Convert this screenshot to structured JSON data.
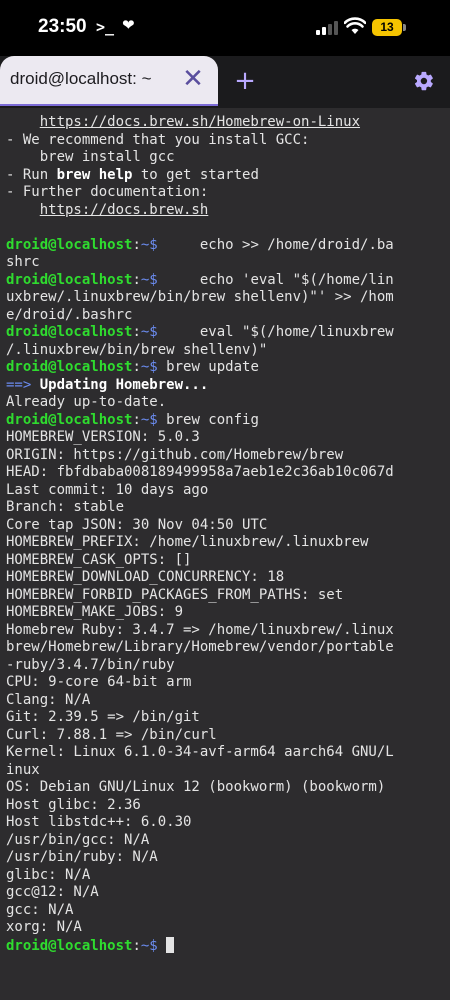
{
  "status_bar": {
    "time": "23:50",
    "terminal_glyph": ">_",
    "heart_glyph": "❤",
    "battery": "13"
  },
  "tab": {
    "title": "droid@localhost: ~",
    "close_glyph": "✕",
    "new_tab_glyph": "+"
  },
  "terminal": {
    "prompt_user": "droid@localhost",
    "prompt_path": "~",
    "lines": [
      {
        "t": "    https://docs.brew.sh/Homebrew-on-Linux"
      },
      {
        "t": "- We recommend that you install GCC:"
      },
      {
        "t": "    brew install gcc"
      },
      {
        "t": "- Run brew help to get started"
      },
      {
        "t": "- Further documentation:"
      },
      {
        "t": "    https://docs.brew.sh"
      },
      {
        "t": ""
      },
      {
        "t": "     echo >> /home/droid/.ba"
      },
      {
        "t": "shrc"
      },
      {
        "t": "     echo 'eval \"$(/home/lin"
      },
      {
        "t": "uxbrew/.linuxbrew/bin/brew shellenv)\"' >> /hom"
      },
      {
        "t": "e/droid/.bashrc"
      },
      {
        "t": "     eval \"$(/home/linuxbrew"
      },
      {
        "t": "/.linuxbrew/bin/brew shellenv)\""
      },
      {
        "t": " brew update"
      },
      {
        "t": "Updating Homebrew..."
      },
      {
        "t": "Already up-to-date."
      },
      {
        "t": " brew config"
      },
      {
        "t": "HOMEBREW_VERSION: 5.0.3"
      },
      {
        "t": "ORIGIN: https://github.com/Homebrew/brew"
      },
      {
        "t": "HEAD: fbfdbaba008189499958a7aeb1e2c36ab10c067d"
      },
      {
        "t": "Last commit: 10 days ago"
      },
      {
        "t": "Branch: stable"
      },
      {
        "t": "Core tap JSON: 30 Nov 04:50 UTC"
      },
      {
        "t": "HOMEBREW_PREFIX: /home/linuxbrew/.linuxbrew"
      },
      {
        "t": "HOMEBREW_CASK_OPTS: []"
      },
      {
        "t": "HOMEBREW_DOWNLOAD_CONCURRENCY: 18"
      },
      {
        "t": "HOMEBREW_FORBID_PACKAGES_FROM_PATHS: set"
      },
      {
        "t": "HOMEBREW_MAKE_JOBS: 9"
      },
      {
        "t": "Homebrew Ruby: 3.4.7 => /home/linuxbrew/.linux"
      },
      {
        "t": "brew/Homebrew/Library/Homebrew/vendor/portable"
      },
      {
        "t": "-ruby/3.4.7/bin/ruby"
      },
      {
        "t": "CPU: 9-core 64-bit arm"
      },
      {
        "t": "Clang: N/A"
      },
      {
        "t": "Git: 2.39.5 => /bin/git"
      },
      {
        "t": "Curl: 7.88.1 => /bin/curl"
      },
      {
        "t": "Kernel: Linux 6.1.0-34-avf-arm64 aarch64 GNU/L"
      },
      {
        "t": "inux"
      },
      {
        "t": "OS: Debian GNU/Linux 12 (bookworm) (bookworm)"
      },
      {
        "t": "Host glibc: 2.36"
      },
      {
        "t": "Host libstdc++: 6.0.30"
      },
      {
        "t": "/usr/bin/gcc: N/A"
      },
      {
        "t": "/usr/bin/ruby: N/A"
      },
      {
        "t": "glibc: N/A"
      },
      {
        "t": "gcc@12: N/A"
      },
      {
        "t": "gcc: N/A"
      },
      {
        "t": "xorg: N/A"
      },
      {
        "t": " "
      }
    ],
    "help_cmd": "brew help",
    "arrow": "==>"
  }
}
